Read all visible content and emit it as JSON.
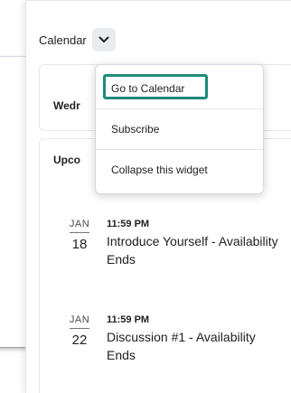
{
  "widget": {
    "title": "Calendar"
  },
  "cards": {
    "date_heading_partial": "Wedr",
    "upcoming_heading_partial": "Upco"
  },
  "menu": {
    "items": [
      {
        "label": "Go to Calendar",
        "focused": true
      },
      {
        "label": "Subscribe"
      },
      {
        "label": "Collapse this widget"
      }
    ]
  },
  "events": [
    {
      "month": "JAN",
      "day": "18",
      "time": "11:59 PM",
      "title": "Introduce Yourself - Availability Ends"
    },
    {
      "month": "JAN",
      "day": "22",
      "time": "11:59 PM",
      "title": "Discussion #1 - Availability Ends"
    }
  ],
  "colors": {
    "focus_ring": "#1f8a7a",
    "chevron_button_bg": "#e9ecef"
  },
  "icons": {
    "menu_toggle": "chevron-down-icon"
  }
}
